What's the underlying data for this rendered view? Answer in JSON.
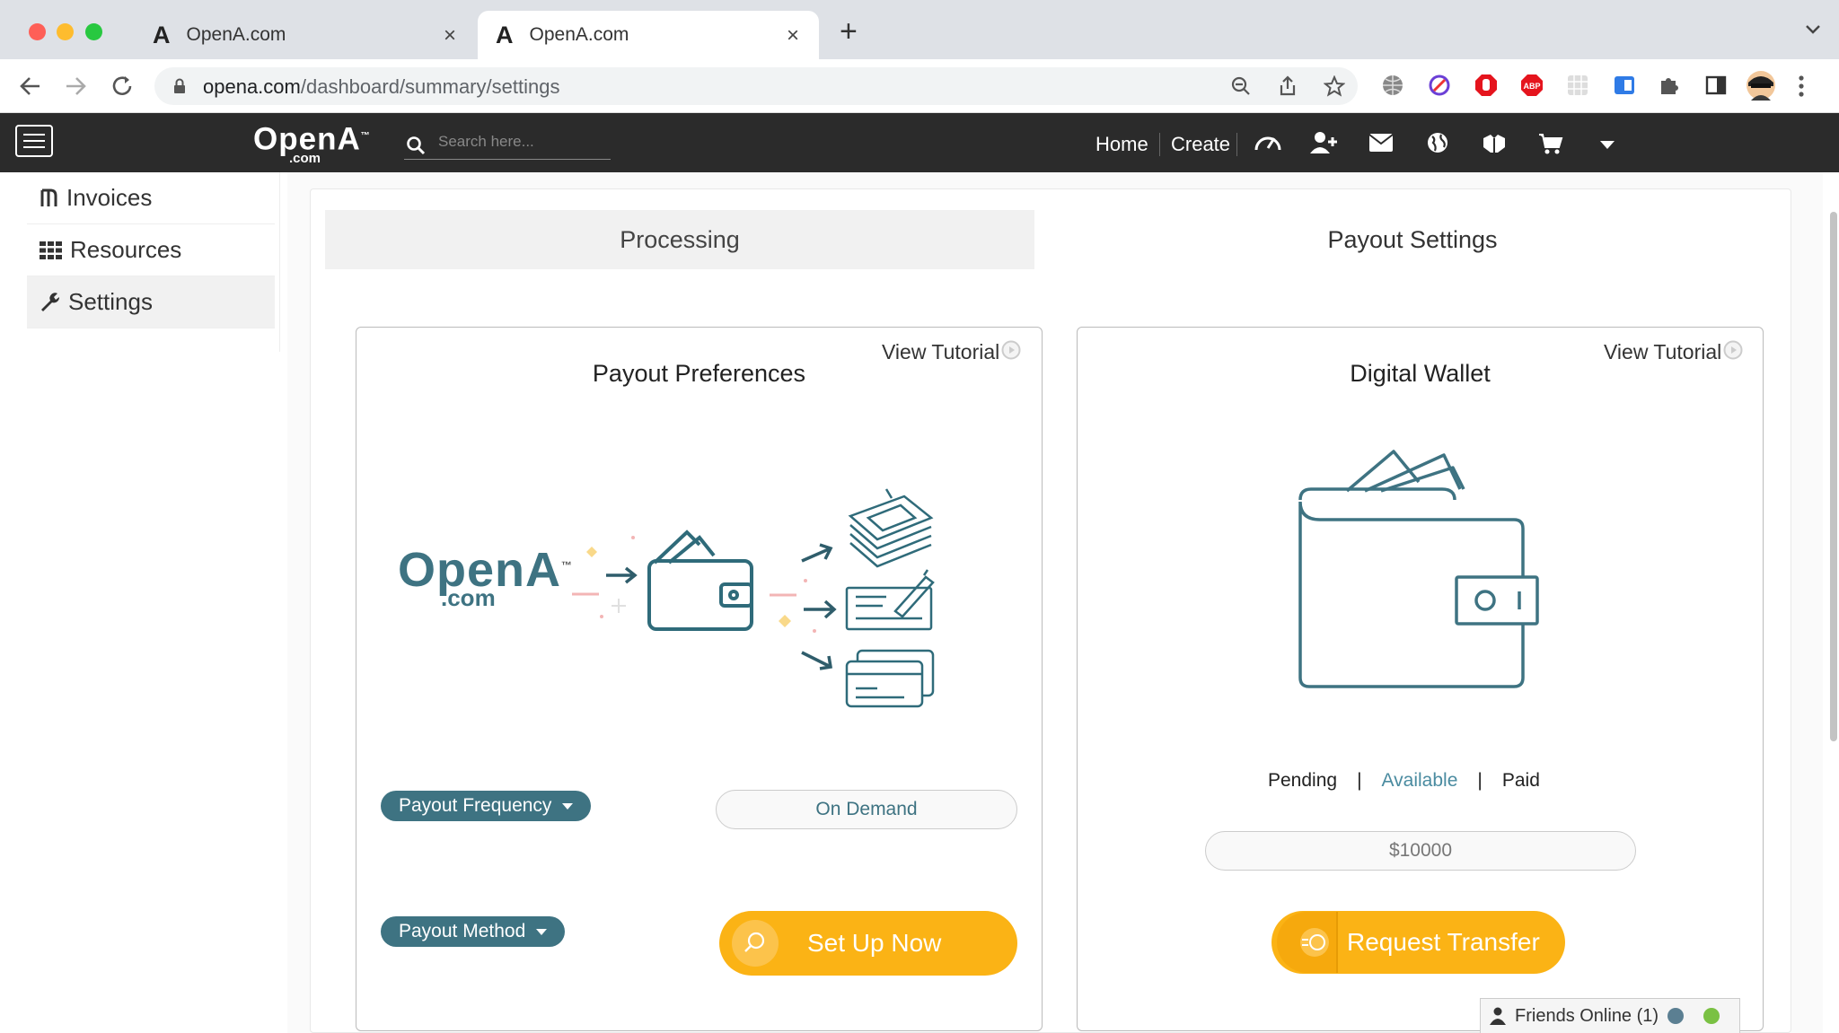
{
  "browser": {
    "tabs": [
      {
        "title": "OpenA.com",
        "active": false
      },
      {
        "title": "OpenA.com",
        "active": true
      }
    ],
    "url_domain": "opena.com",
    "url_path": "/dashboard/summary/settings"
  },
  "header": {
    "brand_main": "OpenA",
    "brand_tm": "™",
    "brand_sub": ".com",
    "search_placeholder": "Search here...",
    "nav": [
      "Home",
      "Create"
    ],
    "icons": [
      "speedometer-icon",
      "add-user-icon",
      "envelope-icon",
      "globe-icon",
      "handshake-icon",
      "cart-icon",
      "caret-down-icon"
    ]
  },
  "sidebar": {
    "items": [
      {
        "label": "Invoices",
        "icon": "invoice-icon",
        "active": false
      },
      {
        "label": "Resources",
        "icon": "grid-icon",
        "active": false
      },
      {
        "label": "Settings",
        "icon": "wrench-icon",
        "active": true
      }
    ]
  },
  "tabs": {
    "processing": "Processing",
    "payout_settings": "Payout Settings"
  },
  "payout_preferences": {
    "view_tutorial": "View Tutorial",
    "title": "Payout Preferences",
    "illustration_logo_main": "OpenA",
    "illustration_logo_tm": "™",
    "illustration_logo_sub": ".com",
    "frequency_label": "Payout Frequency",
    "frequency_value": "On Demand",
    "method_label": "Payout Method",
    "setup_button": "Set Up Now"
  },
  "digital_wallet": {
    "view_tutorial": "View Tutorial",
    "title": "Digital Wallet",
    "status_pending": "Pending",
    "status_available": "Available",
    "status_paid": "Paid",
    "status_separator": "|",
    "amount": "$10000",
    "transfer_button": "Request Transfer"
  },
  "friends": {
    "label": "Friends Online (1)"
  },
  "colors": {
    "accent_teal": "#3e7382",
    "button_yellow": "#fbb315",
    "header_bg": "#2b2b2b",
    "link_blue": "#4a8ba0"
  }
}
